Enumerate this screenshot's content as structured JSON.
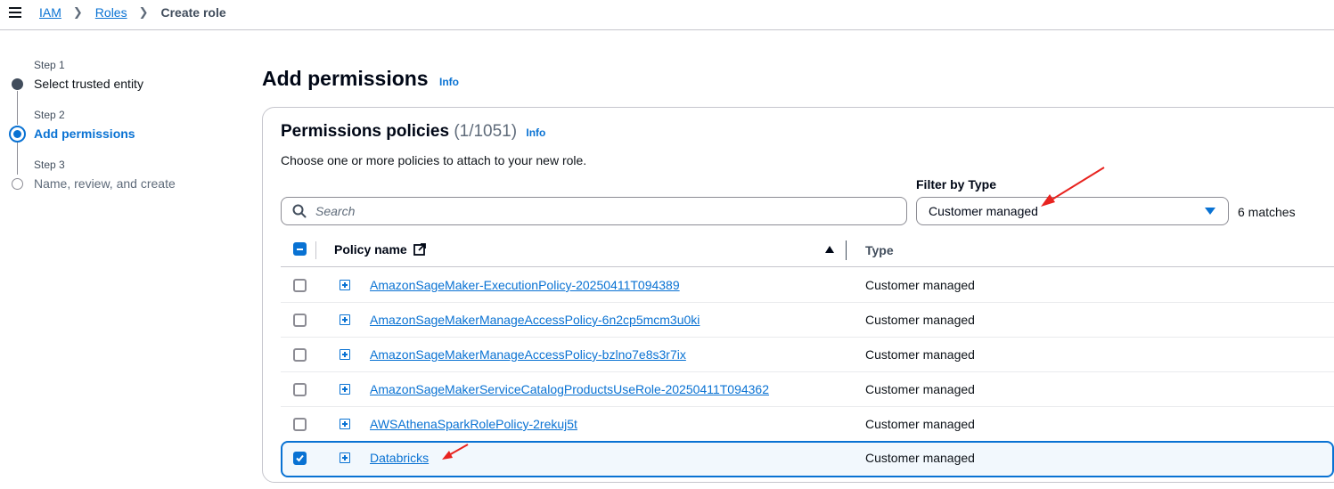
{
  "breadcrumb": {
    "items": [
      "IAM",
      "Roles"
    ],
    "current": "Create role"
  },
  "steps": [
    {
      "label": "Step 1",
      "title": "Select trusted entity",
      "state": "completed"
    },
    {
      "label": "Step 2",
      "title": "Add permissions",
      "state": "active"
    },
    {
      "label": "Step 3",
      "title": "Name, review, and create",
      "state": "pending"
    }
  ],
  "header": {
    "title": "Add permissions",
    "info": "Info"
  },
  "policies": {
    "title": "Permissions policies",
    "count": "(1/1051)",
    "info": "Info",
    "description": "Choose one or more policies to attach to your new role.",
    "search_placeholder": "Search",
    "filter_label": "Filter by Type",
    "filter_value": "Customer managed",
    "matches": "6 matches",
    "columns": {
      "name": "Policy name",
      "type": "Type"
    },
    "rows": [
      {
        "name": "AmazonSageMaker-ExecutionPolicy-20250411T094389",
        "type": "Customer managed",
        "checked": false
      },
      {
        "name": "AmazonSageMakerManageAccessPolicy-6n2cp5mcm3u0ki",
        "type": "Customer managed",
        "checked": false
      },
      {
        "name": "AmazonSageMakerManageAccessPolicy-bzlno7e8s3r7ix",
        "type": "Customer managed",
        "checked": false
      },
      {
        "name": "AmazonSageMakerServiceCatalogProductsUseRole-20250411T094362",
        "type": "Customer managed",
        "checked": false
      },
      {
        "name": "AWSAthenaSparkRolePolicy-2rekuj5t",
        "type": "Customer managed",
        "checked": false
      },
      {
        "name": "Databricks",
        "type": "Customer managed",
        "checked": true
      }
    ]
  },
  "colors": {
    "link": "#0972d3",
    "annotation_arrow": "#e8231f"
  }
}
